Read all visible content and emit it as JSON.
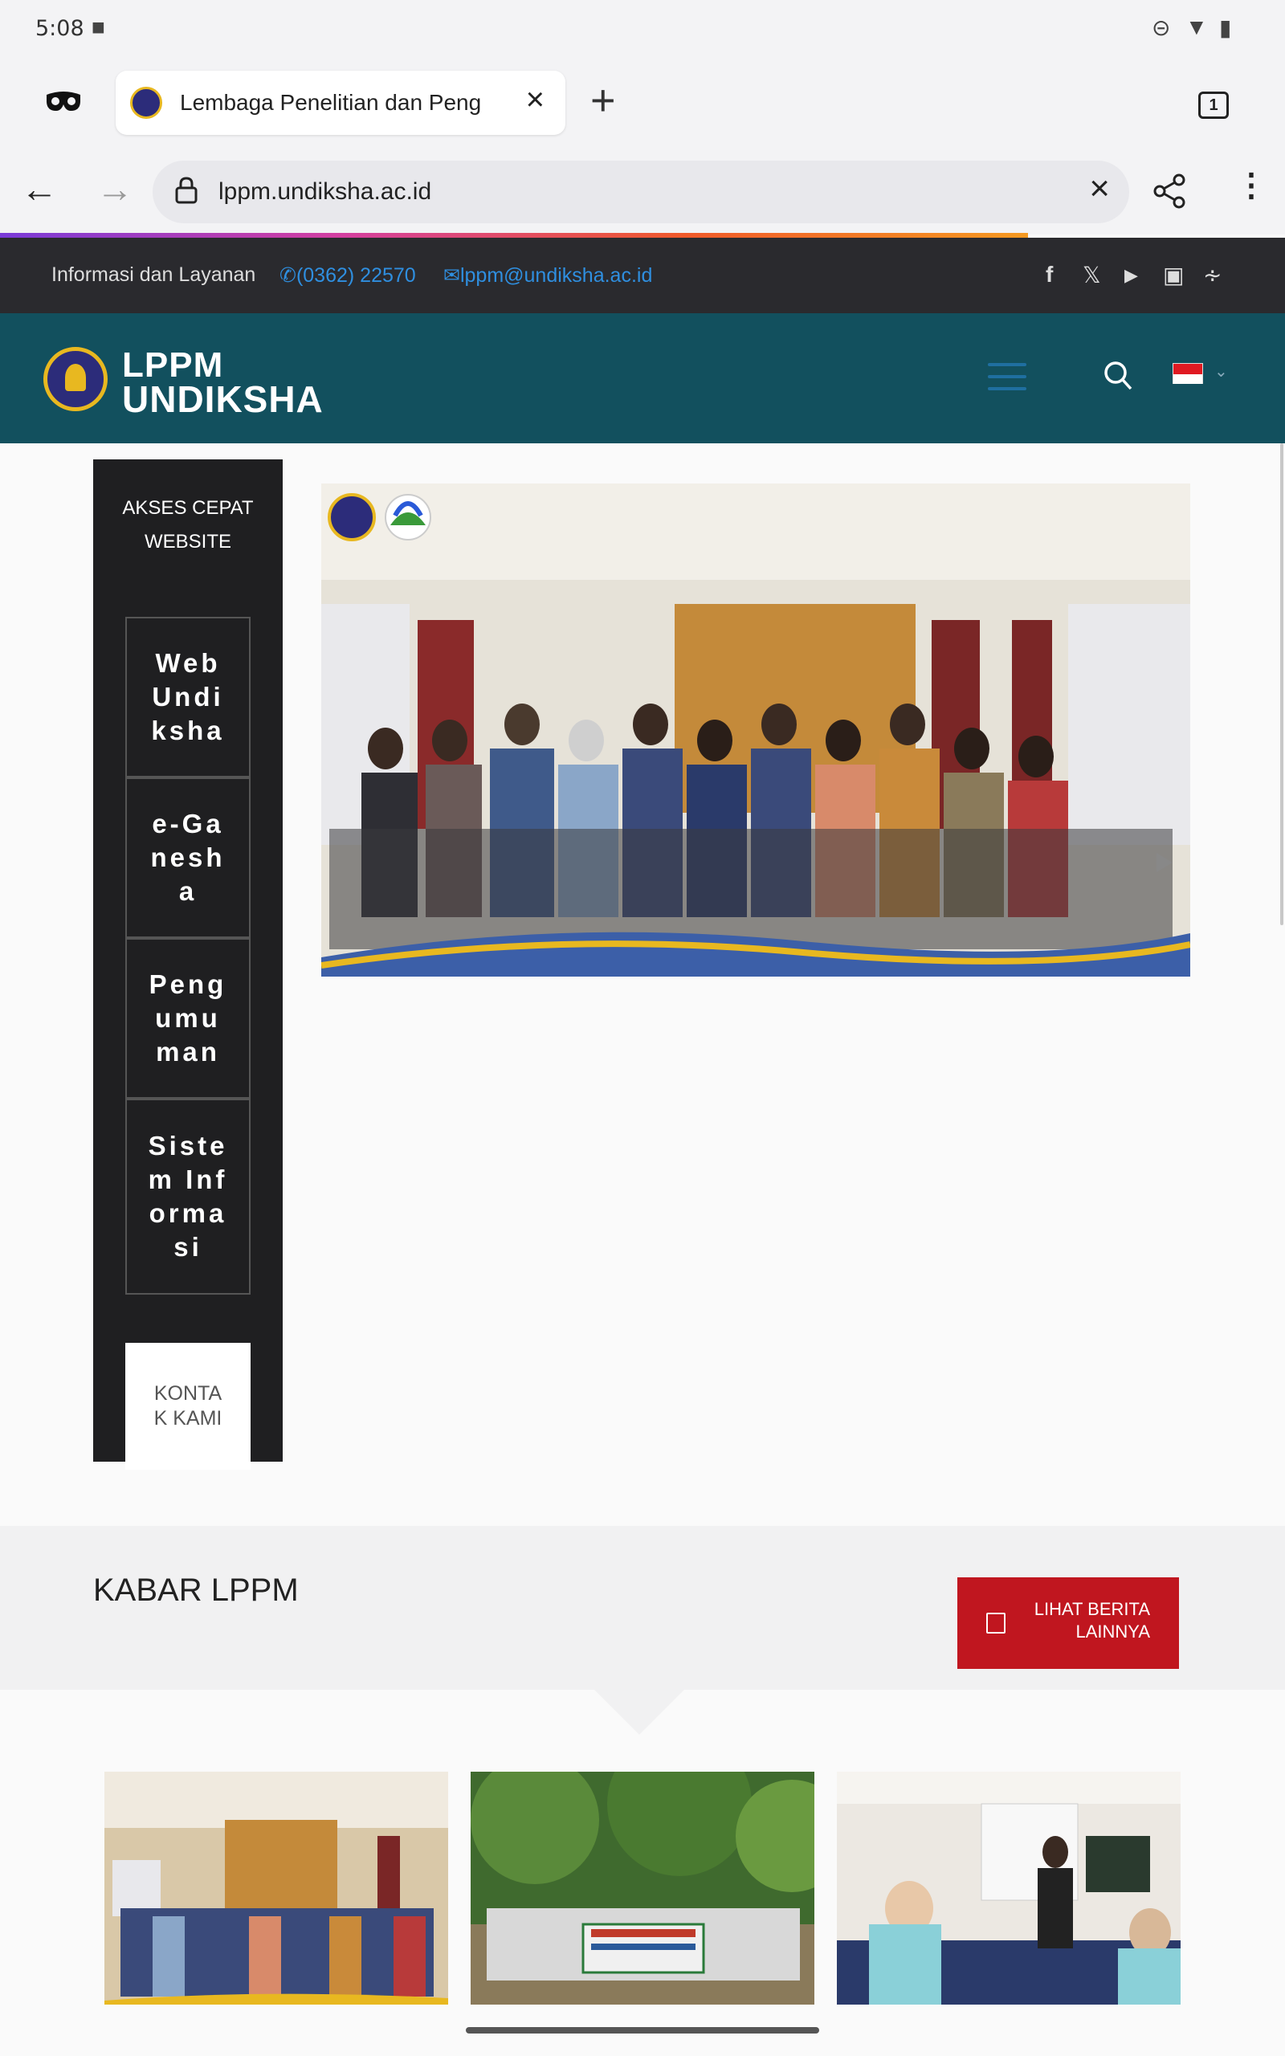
{
  "status_bar": {
    "time": "5:08"
  },
  "browser": {
    "tab": {
      "title": "Lembaga Penelitian dan Peng"
    },
    "tab_count": "1",
    "url": "lppm.undiksha.ac.id"
  },
  "info_bar": {
    "label": "Informasi dan Layanan",
    "phone": "(0362) 22570",
    "email": "lppm@undiksha.ac.id"
  },
  "header": {
    "logo_line1": "LPPM",
    "logo_line2": "UNDIKSHA"
  },
  "sidebar": {
    "title": "AKSES CEPAT WEBSITE",
    "links": [
      {
        "label": "Web Undiksha"
      },
      {
        "label": "e-Ganesha"
      },
      {
        "label": "Pengumuman"
      },
      {
        "label": "Sistem Informasi"
      }
    ],
    "contact_label": "KONTAK KAMI"
  },
  "news": {
    "title": "KABAR LPPM",
    "more_button": "LIHAT BERITA LAINNYA"
  },
  "colors": {
    "header_bg": "#12505e",
    "info_bar_bg": "#2a2a2e",
    "sidebar_bg": "#1f1f21",
    "button_red": "#c0161f",
    "link_blue": "#2f8fe0"
  }
}
